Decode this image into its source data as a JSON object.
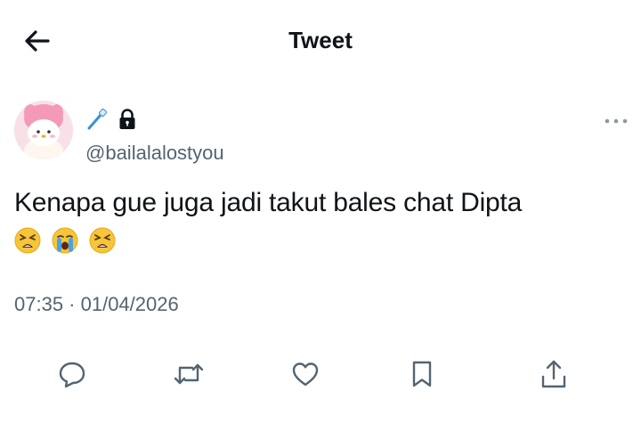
{
  "header": {
    "title": "Tweet",
    "back_icon": "arrow-left-icon"
  },
  "author": {
    "display_name_icons": [
      "toothbrush-emoji",
      "lock-icon"
    ],
    "handle": "@bailalalostyou",
    "avatar": "avatar-image"
  },
  "tweet": {
    "text": "Kenapa gue juga jadi takut bales chat Dipta",
    "emojis": [
      "tired-face-emoji",
      "loudly-crying-face-emoji",
      "tired-face-emoji"
    ],
    "timestamp": "07:35 · 01/04/2026"
  },
  "actions": [
    "reply-icon",
    "retweet-icon",
    "like-icon",
    "bookmark-icon",
    "share-icon"
  ],
  "colors": {
    "text_primary": "#0f1419",
    "text_secondary": "#536471",
    "emoji_yellow": "#f7c53b"
  }
}
